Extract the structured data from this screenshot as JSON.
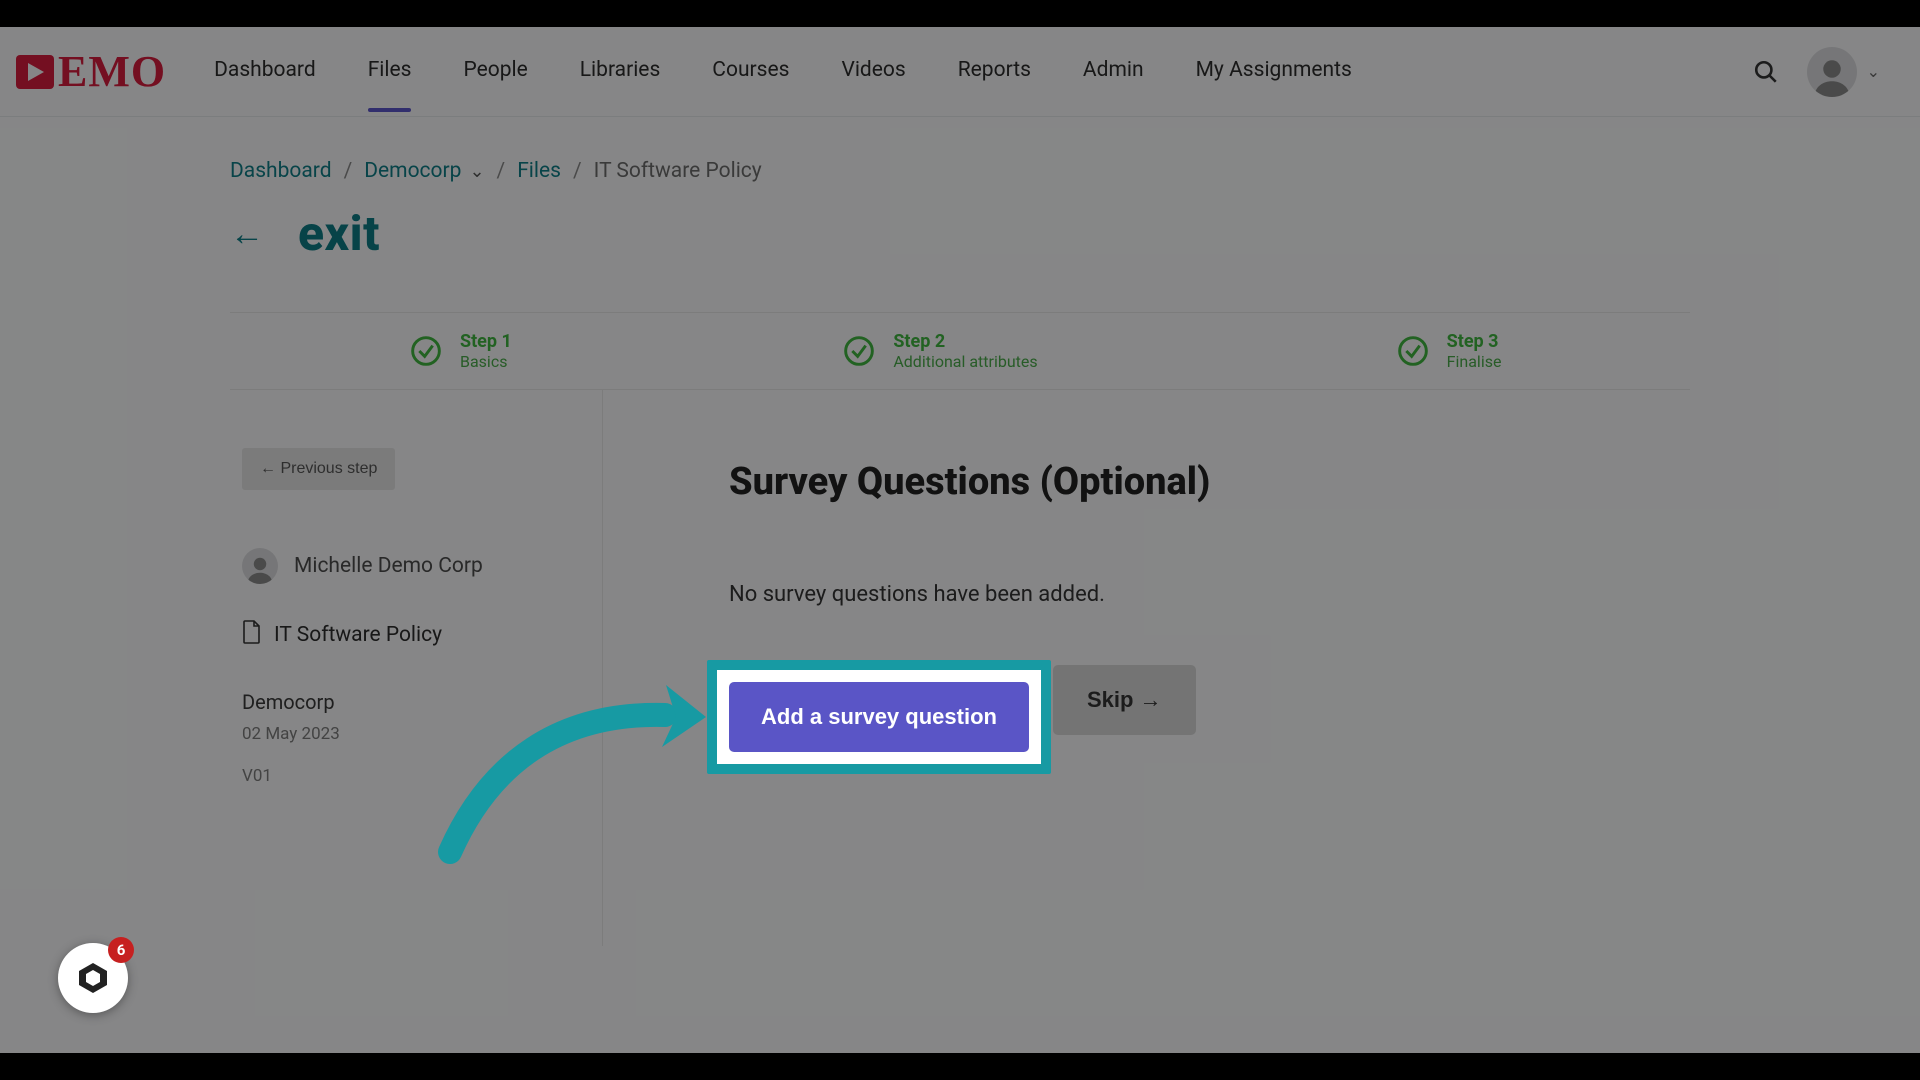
{
  "header": {
    "logo_text": "DEMO",
    "nav": [
      "Dashboard",
      "Files",
      "People",
      "Libraries",
      "Courses",
      "Videos",
      "Reports",
      "Admin",
      "My Assignments"
    ],
    "active_nav_index": 1
  },
  "breadcrumbs": {
    "items": [
      {
        "label": "Dashboard",
        "link": true
      },
      {
        "label": "Democorp",
        "link": true,
        "dropdown": true
      },
      {
        "label": "Files",
        "link": true
      },
      {
        "label": "IT Software Policy",
        "link": false
      }
    ]
  },
  "exit_label": "exit",
  "steps": [
    {
      "title": "Step 1",
      "subtitle": "Basics"
    },
    {
      "title": "Step 2",
      "subtitle": "Additional attributes"
    },
    {
      "title": "Step 3",
      "subtitle": "Finalise"
    }
  ],
  "side": {
    "prev_button": "← Previous step",
    "user_name": "Michelle Demo Corp",
    "doc_title": "IT Software Policy",
    "org": "Democorp",
    "date": "02 May 2023",
    "version": "V01"
  },
  "main": {
    "title": "Survey Questions (Optional)",
    "empty_text": "No survey questions have been added.",
    "add_button": "Add a survey question",
    "skip_button": "Skip  →"
  },
  "float_badge_count": "6"
}
